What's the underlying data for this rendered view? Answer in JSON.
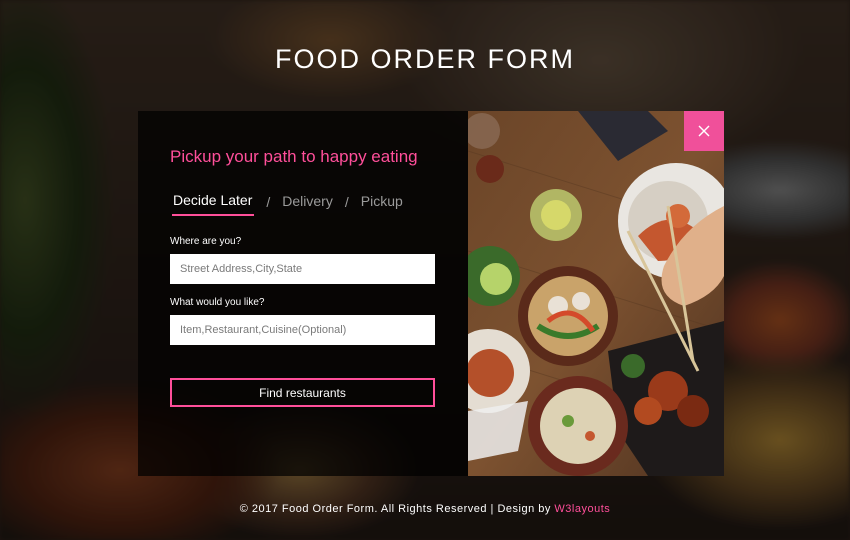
{
  "page": {
    "title": "FOOD ORDER FORM"
  },
  "form": {
    "heading": "Pickup your path to happy eating",
    "tabs": [
      {
        "label": "Decide Later",
        "active": true
      },
      {
        "label": "Delivery",
        "active": false
      },
      {
        "label": "Pickup",
        "active": false
      }
    ],
    "separator": "/",
    "location_label": "Where are you?",
    "location_placeholder": "Street Address,City,State",
    "location_value": "",
    "item_label": "What would you like?",
    "item_placeholder": "Item,Restaurant,Cuisine(Optional)",
    "item_value": "",
    "submit_label": "Find restaurants"
  },
  "close_button": {
    "icon": "close-icon"
  },
  "footer": {
    "text": "© 2017 Food Order Form. All Rights Reserved | Design by",
    "link_label": "W3layouts"
  },
  "colors": {
    "accent": "#ff4f9a",
    "close_bg": "#f0509a",
    "panel_bg": "rgba(0,0,0,0.72)",
    "text": "#ffffff"
  }
}
